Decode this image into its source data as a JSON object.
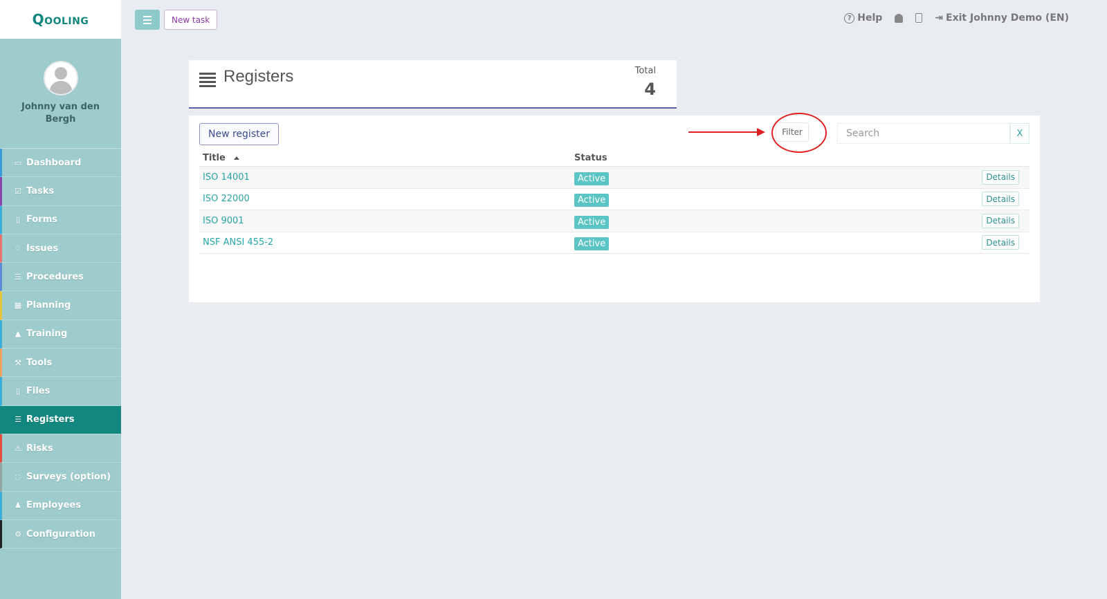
{
  "app": {
    "logo": "Qooling"
  },
  "topbar": {
    "new_task_label": "New task",
    "help_label": "Help",
    "help_icon_glyph": "?",
    "exit_label": "Exit Johnny Demo (EN)",
    "exit_icon_glyph": "⇥"
  },
  "profile": {
    "name": "Johnny van den Bergh"
  },
  "sidebar": {
    "items": [
      {
        "label": "Dashboard",
        "icon": "monitor-icon",
        "glyph": "▭",
        "color": "#3b9ad9"
      },
      {
        "label": "Tasks",
        "icon": "check-square-icon",
        "glyph": "☑",
        "color": "#8e44ad"
      },
      {
        "label": "Forms",
        "icon": "file-icon",
        "glyph": "▯",
        "color": "#3aaed8"
      },
      {
        "label": "Issues",
        "icon": "bell-icon",
        "glyph": "♢",
        "color": "#e8736c"
      },
      {
        "label": "Procedures",
        "icon": "list-icon",
        "glyph": "☰",
        "color": "#5b8dd6"
      },
      {
        "label": "Planning",
        "icon": "calendar-icon",
        "glyph": "▦",
        "color": "#e6c43c"
      },
      {
        "label": "Training",
        "icon": "graduation-cap-icon",
        "glyph": "▲",
        "color": "#3aaed8"
      },
      {
        "label": "Tools",
        "icon": "wrench-icon",
        "glyph": "⚒",
        "color": "#f0a35e"
      },
      {
        "label": "Files",
        "icon": "file-pdf-icon",
        "glyph": "▯",
        "color": "#3aaed8"
      },
      {
        "label": "Registers",
        "icon": "list-icon",
        "glyph": "☰",
        "color": "#12877f"
      },
      {
        "label": "Risks",
        "icon": "warning-icon",
        "glyph": "⚠",
        "color": "#e74c3c"
      },
      {
        "label": "Surveys (option)",
        "icon": "comments-icon",
        "glyph": "◌",
        "color": "#95a5a6"
      },
      {
        "label": "Employees",
        "icon": "users-icon",
        "glyph": "♟",
        "color": "#3aaed8"
      },
      {
        "label": "Configuration",
        "icon": "gear-icon",
        "glyph": "⚙",
        "color": "#222222"
      }
    ],
    "active_index": 9
  },
  "header": {
    "title": "Registers",
    "total_label": "Total",
    "total_value": "4"
  },
  "toolbar": {
    "new_register_label": "New register",
    "filter_label": "Filter",
    "search_placeholder": "Search",
    "clear_label": "X"
  },
  "table": {
    "columns": [
      "Title",
      "Status"
    ],
    "rows": [
      {
        "title": "ISO 14001",
        "status": "Active",
        "action": "Details"
      },
      {
        "title": "ISO 22000",
        "status": "Active",
        "action": "Details"
      },
      {
        "title": "ISO 9001",
        "status": "Active",
        "action": "Details"
      },
      {
        "title": "NSF ANSI 455-2",
        "status": "Active",
        "action": "Details"
      }
    ]
  },
  "colors": {
    "accent": "#12877f",
    "sidebar_bg": "#9ecccc",
    "annotation": "#e02020"
  }
}
